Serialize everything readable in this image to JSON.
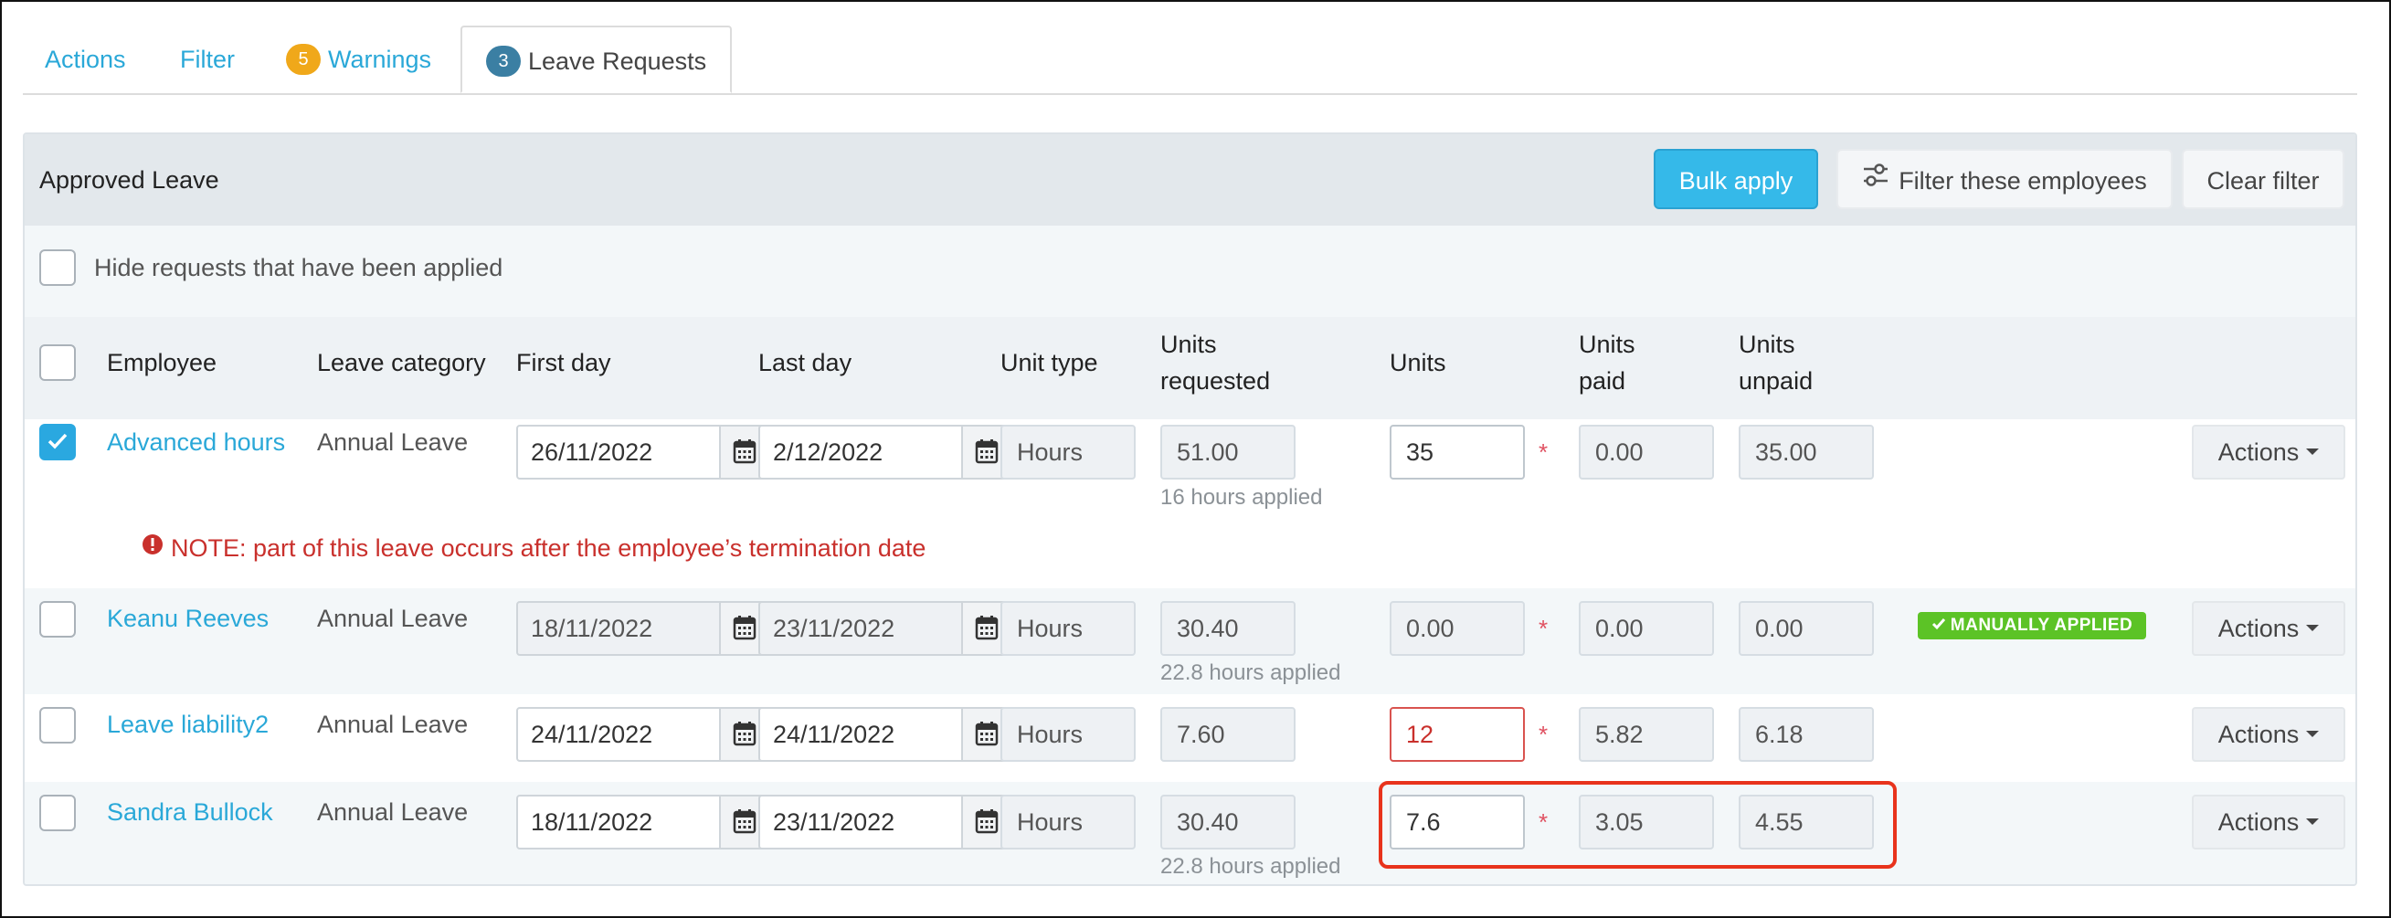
{
  "tabs": [
    {
      "label": "Actions"
    },
    {
      "label": "Filter"
    },
    {
      "label": "Warnings",
      "badge": "5"
    },
    {
      "label": "Leave Requests",
      "badge": "3"
    }
  ],
  "panel": {
    "title": "Approved Leave",
    "bulk_apply": "Bulk apply",
    "filter_employees": "Filter these employees",
    "clear_filter": "Clear filter",
    "hide_applied_label": "Hide requests that have been applied"
  },
  "columns": {
    "employee": "Employee",
    "leave_category": "Leave category",
    "first_day": "First day",
    "last_day": "Last day",
    "unit_type": "Unit type",
    "units_requested_1": "Units",
    "units_requested_2": "requested",
    "units": "Units",
    "units_paid_1": "Units",
    "units_paid_2": "paid",
    "units_unpaid_1": "Units",
    "units_unpaid_2": "unpaid"
  },
  "rows": [
    {
      "employee": "Advanced hours",
      "category": "Annual Leave",
      "first_day": "26/11/2022",
      "last_day": "2/12/2022",
      "unit_type": "Hours",
      "requested": "51.00",
      "applied_note": "16 hours applied",
      "units": "35",
      "paid": "0.00",
      "unpaid": "35.00",
      "note": "NOTE: part of this leave occurs after the employee’s termination date",
      "actions": "Actions"
    },
    {
      "employee": "Keanu Reeves",
      "category": "Annual Leave",
      "first_day": "18/11/2022",
      "last_day": "23/11/2022",
      "unit_type": "Hours",
      "requested": "30.40",
      "applied_note": "22.8 hours applied",
      "units": "0.00",
      "paid": "0.00",
      "unpaid": "0.00",
      "status_badge": "MANUALLY APPLIED",
      "actions": "Actions"
    },
    {
      "employee": "Leave liability2",
      "category": "Annual Leave",
      "first_day": "24/11/2022",
      "last_day": "24/11/2022",
      "unit_type": "Hours",
      "requested": "7.60",
      "units": "12",
      "paid": "5.82",
      "unpaid": "6.18",
      "actions": "Actions"
    },
    {
      "employee": "Sandra Bullock",
      "category": "Annual Leave",
      "first_day": "18/11/2022",
      "last_day": "23/11/2022",
      "unit_type": "Hours",
      "requested": "30.40",
      "applied_note": "22.8 hours applied",
      "units": "7.6",
      "paid": "3.05",
      "unpaid": "4.55",
      "actions": "Actions"
    }
  ],
  "required_marker": "*",
  "colors": {
    "link": "#2aa8d8",
    "primary": "#35b9e9",
    "warning_badge": "#f0a81a",
    "info_badge": "#3b7fa3",
    "error": "#c9302c",
    "success_badge": "#5cc326",
    "highlight": "#e8331c"
  },
  "icons": {
    "filter": "sliders-icon",
    "calendar": "calendar-icon",
    "check": "check-icon",
    "error": "exclamation-circle-icon"
  }
}
